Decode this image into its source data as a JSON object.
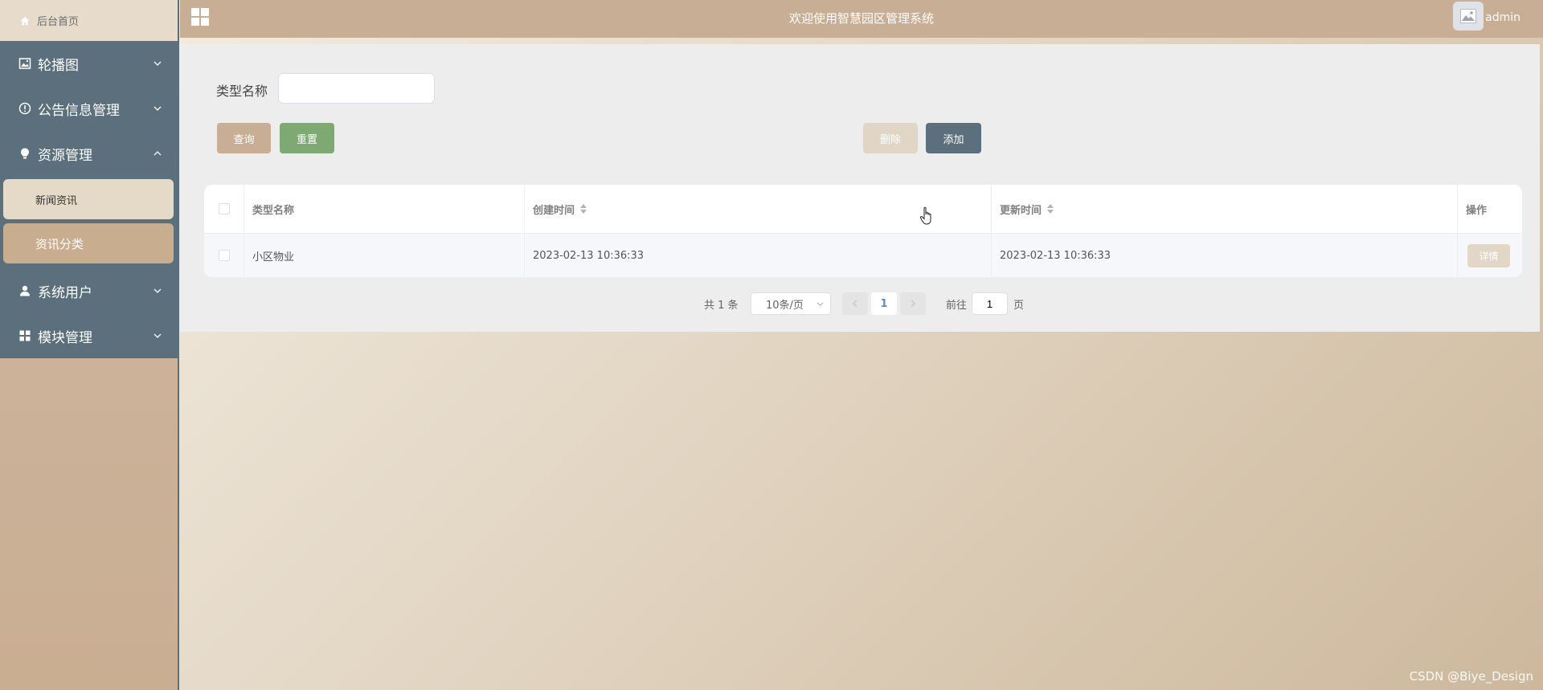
{
  "sidebar": {
    "home_label": "后台首页",
    "groups": [
      {
        "label": "轮播图",
        "icon": "image-icon"
      },
      {
        "label": "公告信息管理",
        "icon": "info-circle-icon"
      },
      {
        "label": "资源管理",
        "icon": "bulb-icon",
        "expanded": true,
        "children": [
          {
            "label": "新闻资讯"
          },
          {
            "label": "资讯分类",
            "active": true
          }
        ]
      },
      {
        "label": "系统用户",
        "icon": "user-icon"
      },
      {
        "label": "模块管理",
        "icon": "grid-icon"
      }
    ]
  },
  "header": {
    "title": "欢迎使用智慧园区管理系统",
    "username": "admin"
  },
  "search": {
    "label": "类型名称",
    "value": "",
    "query_label": "查询",
    "reset_label": "重置",
    "delete_label": "删除",
    "add_label": "添加"
  },
  "table": {
    "columns": [
      "类型名称",
      "创建时间",
      "更新时间",
      "操作"
    ],
    "rows": [
      {
        "name": "小区物业",
        "created": "2023-02-13 10:36:33",
        "updated": "2023-02-13 10:36:33",
        "action": "详情"
      }
    ]
  },
  "pagination": {
    "total_text": "共 1 条",
    "page_size": "10条/页",
    "current_page": "1",
    "goto_prefix": "前往",
    "goto_value": "1",
    "goto_suffix": "页"
  },
  "watermark": "CSDN @Biye_Design",
  "colors": {
    "sidebar_nav": "#5b6f7d",
    "accent_tan": "#c8ae94",
    "reset_green": "#7ea972"
  }
}
